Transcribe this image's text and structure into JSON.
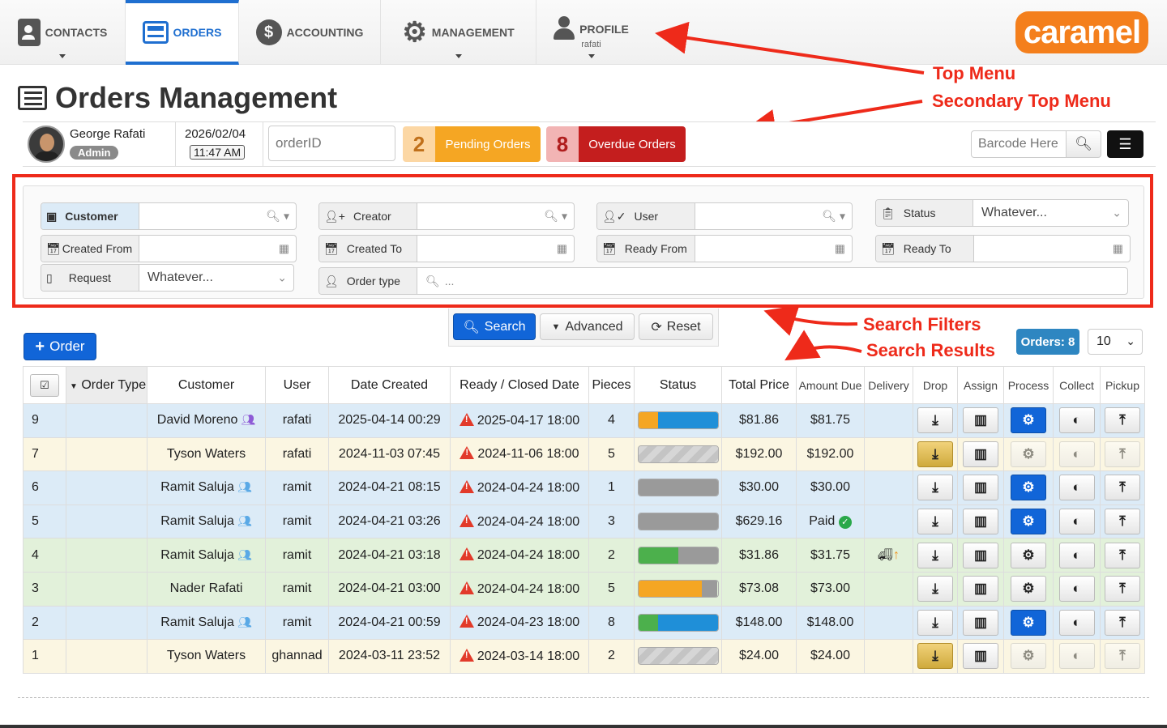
{
  "nav": {
    "tabs": [
      {
        "label": "CONTACTS"
      },
      {
        "label": "ORDERS"
      },
      {
        "label": "ACCOUNTING"
      },
      {
        "label": "MANAGEMENT"
      },
      {
        "label": "PROFILE",
        "sub": "rafati"
      }
    ],
    "logo": "caramel"
  },
  "annotations": {
    "top_menu": "Top Menu",
    "secondary_top_menu": "Secondary Top Menu",
    "search_filters": "Search Filters",
    "search_results": "Search Results"
  },
  "page_title": "Orders Management",
  "secondary": {
    "user_name": "George Rafati",
    "user_role": "Admin",
    "date": "2026/02/04",
    "time": "11:47 AM",
    "order_id_placeholder": "orderID",
    "pending_count": "2",
    "pending_label": "Pending Orders",
    "overdue_count": "8",
    "overdue_label": "Overdue Orders",
    "barcode_placeholder": "Barcode Here"
  },
  "filters": {
    "customer": "Customer",
    "creator": "Creator",
    "user": "User",
    "status": "Status",
    "status_value": "Whatever...",
    "created_from": "Created From",
    "created_to": "Created To",
    "ready_from": "Ready From",
    "ready_to": "Ready To",
    "request": "Request",
    "request_value": "Whatever...",
    "order_type": "Order type",
    "order_type_placeholder": "..."
  },
  "actions": {
    "search": "Search",
    "advanced": "Advanced",
    "reset": "Reset",
    "new_order": "Order",
    "orders_count": "Orders: 8",
    "page_size": "10"
  },
  "table": {
    "headers": [
      "Order Type",
      "Customer",
      "User",
      "Date Created",
      "Ready / Closed Date",
      "Pieces",
      "Status",
      "Total Price",
      "Amount Due",
      "Delivery",
      "Drop",
      "Assign",
      "Process",
      "Collect",
      "Pickup"
    ],
    "rows": [
      {
        "id": "9",
        "customer": "David Moreno",
        "group": "purple",
        "user": "rafati",
        "created": "2025-04-14 00:29",
        "ready": "2025-04-17 18:00",
        "pieces": "4",
        "status": [
          {
            "c": "#f5a623",
            "p": 25
          },
          {
            "c": "#1f8fd8",
            "p": 75
          }
        ],
        "total": "$81.86",
        "due": "$81.75",
        "tint": "rb",
        "drop": "normal",
        "process": "blue",
        "collect": "normal",
        "pickup": "normal"
      },
      {
        "id": "7",
        "customer": "Tyson Waters",
        "group": "",
        "user": "rafati",
        "created": "2024-11-03 07:45",
        "ready": "2024-11-06 18:00",
        "pieces": "5",
        "status": [
          {
            "c": "stripe",
            "p": 100
          }
        ],
        "total": "$192.00",
        "due": "$192.00",
        "tint": "ry",
        "drop": "gold",
        "process": "dis",
        "collect": "dis",
        "pickup": "dis"
      },
      {
        "id": "6",
        "customer": "Ramit Saluja",
        "group": "blue",
        "user": "ramit",
        "created": "2024-04-21 08:15",
        "ready": "2024-04-24 18:00",
        "pieces": "1",
        "status": [
          {
            "c": "#9a9a9a",
            "p": 100
          }
        ],
        "total": "$30.00",
        "due": "$30.00",
        "tint": "rb",
        "drop": "normal",
        "process": "blue",
        "collect": "normal",
        "pickup": "normal"
      },
      {
        "id": "5",
        "customer": "Ramit Saluja",
        "group": "blue",
        "user": "ramit",
        "created": "2024-04-21 03:26",
        "ready": "2024-04-24 18:00",
        "pieces": "3",
        "status": [
          {
            "c": "#9a9a9a",
            "p": 100
          }
        ],
        "total": "$629.16",
        "due": "Paid",
        "paid": true,
        "tint": "rb",
        "drop": "normal",
        "process": "blue",
        "collect": "normal",
        "pickup": "normal"
      },
      {
        "id": "4",
        "customer": "Ramit Saluja",
        "group": "blue",
        "user": "ramit",
        "created": "2024-04-21 03:18",
        "ready": "2024-04-24 18:00",
        "pieces": "2",
        "status": [
          {
            "c": "#4cb04c",
            "p": 50
          },
          {
            "c": "#9a9a9a",
            "p": 50
          }
        ],
        "total": "$31.86",
        "due": "$31.75",
        "delivery": true,
        "tint": "rg",
        "drop": "normal",
        "process": "normal",
        "collect": "normal",
        "pickup": "normal"
      },
      {
        "id": "3",
        "customer": "Nader Rafati",
        "group": "",
        "user": "ramit",
        "created": "2024-04-21 03:00",
        "ready": "2024-04-24 18:00",
        "pieces": "5",
        "status": [
          {
            "c": "#f5a623",
            "p": 80
          },
          {
            "c": "#9a9a9a",
            "p": 20
          }
        ],
        "total": "$73.08",
        "due": "$73.00",
        "tint": "rg",
        "drop": "normal",
        "process": "normal",
        "collect": "normal",
        "pickup": "normal"
      },
      {
        "id": "2",
        "customer": "Ramit Saluja",
        "group": "blue",
        "user": "ramit",
        "created": "2024-04-21 00:59",
        "ready": "2024-04-23 18:00",
        "pieces": "8",
        "status": [
          {
            "c": "#4cb04c",
            "p": 25
          },
          {
            "c": "#1f8fd8",
            "p": 75
          }
        ],
        "total": "$148.00",
        "due": "$148.00",
        "tint": "rb",
        "drop": "normal",
        "process": "blue",
        "collect": "normal",
        "pickup": "normal"
      },
      {
        "id": "1",
        "customer": "Tyson Waters",
        "group": "",
        "user": "ghannad",
        "created": "2024-03-11 23:52",
        "ready": "2024-03-14 18:00",
        "pieces": "2",
        "status": [
          {
            "c": "stripe",
            "p": 100
          }
        ],
        "total": "$24.00",
        "due": "$24.00",
        "tint": "ry",
        "drop": "gold",
        "process": "dis",
        "collect": "dis",
        "pickup": "dis"
      }
    ]
  }
}
